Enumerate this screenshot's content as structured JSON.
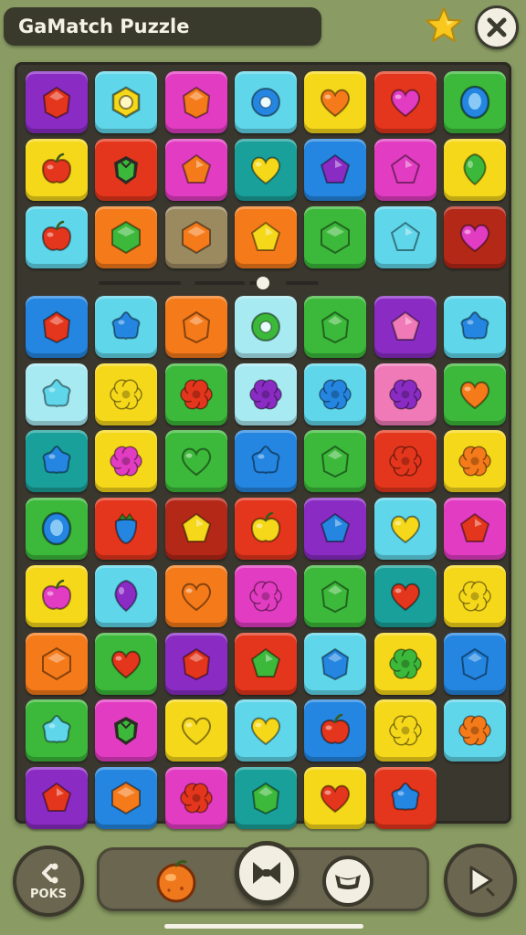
{
  "header": {
    "title": "GaMatch Puzzle",
    "star_icon": "star-icon",
    "close_icon": "close-icon"
  },
  "colors": {
    "purple": "#8a2cc4",
    "cyan": "#5fd6ea",
    "magenta": "#e23cc2",
    "yellow": "#f6d81a",
    "red": "#e4361c",
    "green": "#3cb83a",
    "orange": "#f47a1a",
    "teal": "#1aa09a",
    "blue": "#2486e0",
    "pink": "#f07ab8",
    "tan": "#9b8a60",
    "darkred": "#b42818",
    "lightcyan": "#a8eaf2"
  },
  "board": {
    "columns": 7,
    "rows": [
      [
        [
          "purple",
          "gem",
          "red"
        ],
        [
          "cyan",
          "hexring",
          "yellow"
        ],
        [
          "magenta",
          "gem",
          "orange"
        ],
        [
          "cyan",
          "ring",
          "blue"
        ],
        [
          "yellow",
          "heart",
          "orange"
        ],
        [
          "red",
          "heart",
          "magenta"
        ],
        [
          "green",
          "oval",
          "blue"
        ]
      ],
      [
        [
          "yellow",
          "apple",
          "red"
        ],
        [
          "red",
          "berry",
          "green"
        ],
        [
          "magenta",
          "pent",
          "orange"
        ],
        [
          "teal",
          "heart",
          "yellow"
        ],
        [
          "blue",
          "pent",
          "purple"
        ],
        [
          "magenta",
          "pent",
          "magenta"
        ],
        [
          "yellow",
          "drop",
          "green"
        ]
      ],
      [
        [
          "cyan",
          "apple",
          "red"
        ],
        [
          "orange",
          "hexgem",
          "green"
        ],
        [
          "tan",
          "hexgem",
          "orange"
        ],
        [
          "orange",
          "pent",
          "yellow"
        ],
        [
          "green",
          "hexgem",
          "green"
        ],
        [
          "cyan",
          "pent",
          "cyan"
        ],
        [
          "darkred",
          "heart",
          "magenta"
        ]
      ],
      [
        [
          "blue",
          "gem",
          "red"
        ],
        [
          "cyan",
          "star5",
          "blue"
        ],
        [
          "orange",
          "gem",
          "orange"
        ],
        [
          "lightcyan",
          "ring",
          "green"
        ],
        [
          "green",
          "gem",
          "green"
        ],
        [
          "purple",
          "pent",
          "pink"
        ],
        [
          "cyan",
          "star5",
          "blue"
        ]
      ],
      [
        [
          "lightcyan",
          "star5",
          "cyan"
        ],
        [
          "yellow",
          "flower",
          "yellow"
        ],
        [
          "green",
          "flower",
          "red"
        ],
        [
          "lightcyan",
          "flower",
          "purple"
        ],
        [
          "cyan",
          "flower",
          "blue"
        ],
        [
          "pink",
          "flower",
          "purple"
        ],
        [
          "green",
          "heart",
          "orange"
        ]
      ],
      [
        [
          "teal",
          "star5",
          "blue"
        ],
        [
          "yellow",
          "flower",
          "magenta"
        ],
        [
          "green",
          "heart",
          "green"
        ],
        [
          "blue",
          "star5",
          "blue"
        ],
        [
          "green",
          "gem",
          "green"
        ],
        [
          "red",
          "flower",
          "red"
        ],
        [
          "yellow",
          "flower",
          "orange"
        ]
      ],
      [
        [
          "green",
          "oval",
          "blue"
        ],
        [
          "red",
          "strawberry",
          "blue"
        ],
        [
          "darkred",
          "pent",
          "yellow"
        ],
        [
          "red",
          "apple",
          "yellow"
        ],
        [
          "purple",
          "pent",
          "blue"
        ],
        [
          "cyan",
          "heart",
          "yellow"
        ],
        [
          "magenta",
          "pent",
          "red"
        ]
      ],
      [
        [
          "yellow",
          "apple",
          "magenta"
        ],
        [
          "cyan",
          "drop",
          "purple"
        ],
        [
          "orange",
          "heart",
          "orange"
        ],
        [
          "magenta",
          "flower",
          "magenta"
        ],
        [
          "green",
          "gem",
          "green"
        ],
        [
          "teal",
          "heart",
          "red"
        ],
        [
          "yellow",
          "flower",
          "yellow"
        ]
      ],
      [
        [
          "orange",
          "hexgem",
          "orange"
        ],
        [
          "green",
          "heart",
          "red"
        ],
        [
          "purple",
          "gem",
          "red"
        ],
        [
          "red",
          "pent",
          "green"
        ],
        [
          "cyan",
          "gem",
          "blue"
        ],
        [
          "yellow",
          "flower",
          "green"
        ],
        [
          "blue",
          "gem",
          "blue"
        ]
      ],
      [
        [
          "green",
          "star5",
          "cyan"
        ],
        [
          "magenta",
          "berry",
          "green"
        ],
        [
          "yellow",
          "heart",
          "yellow"
        ],
        [
          "cyan",
          "heart",
          "yellow"
        ],
        [
          "blue",
          "apple",
          "red"
        ],
        [
          "yellow",
          "flower",
          "yellow"
        ],
        [
          "cyan",
          "flower",
          "orange"
        ]
      ],
      [
        [
          "purple",
          "pent",
          "red"
        ],
        [
          "blue",
          "hexgem",
          "orange"
        ],
        [
          "magenta",
          "flower",
          "red"
        ],
        [
          "teal",
          "gem",
          "green"
        ],
        [
          "yellow",
          "heart",
          "red"
        ],
        [
          "red",
          "star5",
          "blue"
        ],
        null
      ]
    ]
  },
  "bottom": {
    "left_label": "POKS",
    "left_icon": "link-icon",
    "fruit_icon": "orange-fruit-icon",
    "center_icon": "bowtie-icon",
    "right_icon": "crown-icon",
    "play_icon": "play-icon"
  }
}
